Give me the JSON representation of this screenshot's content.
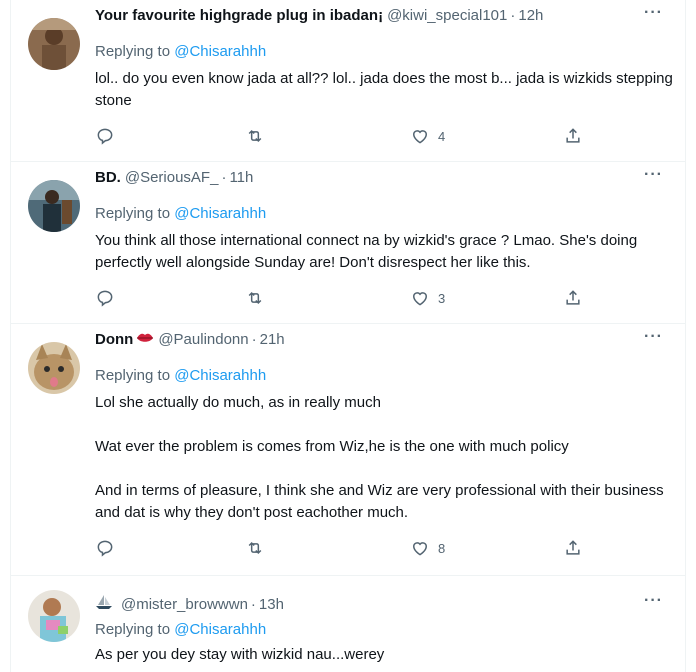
{
  "tweets": [
    {
      "name": "Your favourite highgrade plug in ibadan¡",
      "handle": "@kiwi_special101",
      "time": "12h",
      "reply_prefix": "Replying to",
      "reply_to": "@Chisarahhh",
      "lines": [
        "lol.. do you even know jada at all?? lol.. jada does the most b... jada is wizkids stepping stone"
      ],
      "likes": "4"
    },
    {
      "name": "BD.",
      "handle": "@SeriousAF_",
      "time": "11h",
      "reply_prefix": "Replying to",
      "reply_to": "@Chisarahhh",
      "lines": [
        "You think all those international connect na by wizkid's grace ? Lmao. She's doing perfectly well alongside Sunday are! Don't disrespect her like this."
      ],
      "likes": "3"
    },
    {
      "name": "Donn",
      "name_emoji": "lips-icon",
      "handle": "@Paulindonn",
      "time": "21h",
      "reply_prefix": "Replying to",
      "reply_to": "@Chisarahhh",
      "lines": [
        "Lol she actually do much, as in really much",
        "Wat ever the problem is comes from Wiz,he is the one with much policy",
        "And in terms of pleasure, I think she and Wiz are very professional with their business and dat is why they don't post eachother much."
      ],
      "likes": "8"
    },
    {
      "name": "",
      "name_emoji": "ship-icon",
      "handle": "@mister_browwwn",
      "time": "13h",
      "reply_prefix": "Replying to",
      "reply_to": "@Chisarahhh",
      "lines": [
        "As per you dey stay with wizkid nau...werey"
      ]
    }
  ],
  "ui": {
    "dot": "·",
    "more": "···",
    "accent": "#1d9bf0",
    "muted": "#536471"
  }
}
